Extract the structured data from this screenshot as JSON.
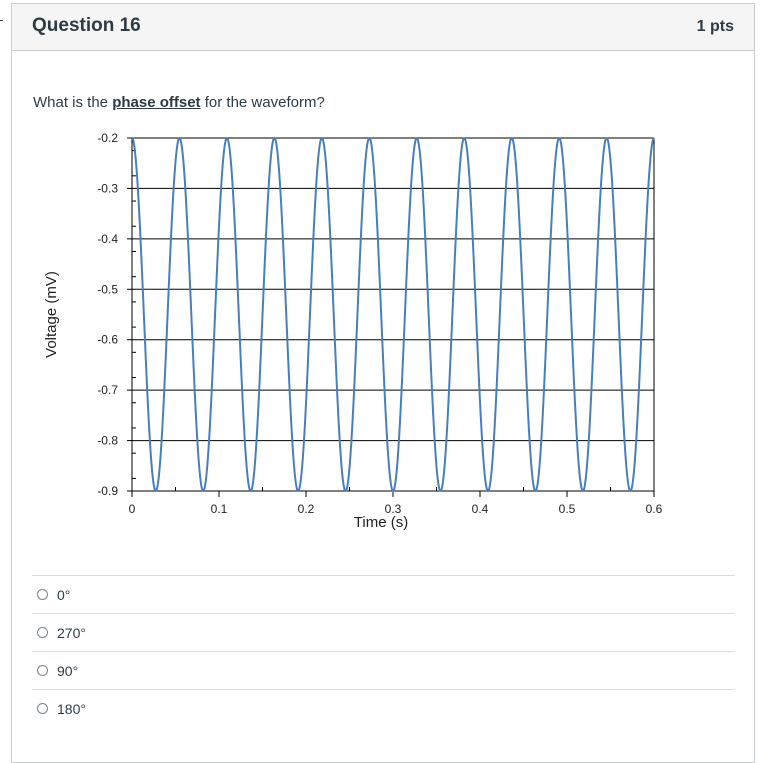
{
  "question": {
    "title": "Question 16",
    "points": "1 pts",
    "prompt_before": "What is the ",
    "prompt_emphasis": "phase offset",
    "prompt_after": " for the waveform?"
  },
  "answers": [
    {
      "label": "0°"
    },
    {
      "label": "270°"
    },
    {
      "label": "90°"
    },
    {
      "label": "180°"
    }
  ],
  "chart_data": {
    "type": "line",
    "title": "",
    "xlabel": "Time (s)",
    "ylabel": "Voltage (mV)",
    "xlim": [
      0,
      0.6
    ],
    "ylim": [
      -0.9,
      -0.2
    ],
    "x_ticks": [
      "0",
      "0.1",
      "0.2",
      "0.3",
      "0.4",
      "0.5",
      "0.6"
    ],
    "y_ticks": [
      "-0.2",
      "-0.3",
      "-0.4",
      "-0.5",
      "-0.6",
      "-0.7",
      "-0.8",
      "-0.9"
    ],
    "grid": "horizontal",
    "series": [
      {
        "color": "#4a7ebb",
        "function": "sine",
        "offset": -0.55,
        "amplitude": 0.35,
        "frequency_hz": 18.33,
        "phase_deg": 90,
        "start_value": -0.2,
        "end_value": -0.2
      }
    ]
  }
}
